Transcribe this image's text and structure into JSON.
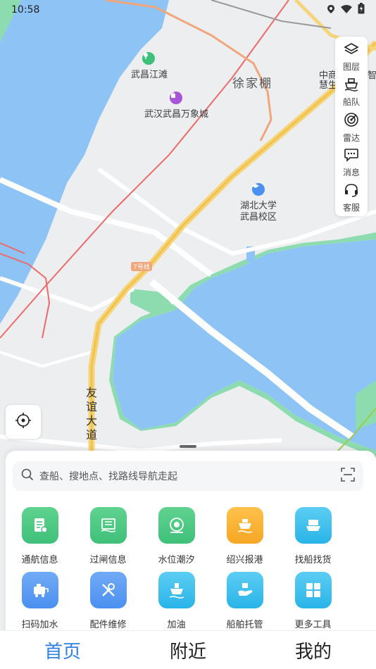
{
  "status_bar": {
    "time": "10:58"
  },
  "map": {
    "labels": {
      "wuchang_jiangtan": "武昌江滩",
      "xujiapeng": "徐家棚",
      "wanxiangcheng": "武汉武昌万象城",
      "hubei_univ_line1": "湖北大学",
      "hubei_univ_line2": "武昌校区",
      "zhongshang_line1": "中商",
      "zhongshang_line2": "慧生",
      "zhi": "智",
      "road_youyi": "友谊大道",
      "metro_badge": "7号线"
    }
  },
  "side_toolbar": {
    "items": [
      {
        "label": "图层",
        "icon": "layers-icon"
      },
      {
        "label": "船队",
        "icon": "ship-fleet-icon"
      },
      {
        "label": "雷达",
        "icon": "radar-icon"
      },
      {
        "label": "消息",
        "icon": "message-icon"
      },
      {
        "label": "客服",
        "icon": "headset-icon"
      }
    ]
  },
  "search": {
    "placeholder": "查船、搜地点、找路线导航走起"
  },
  "grid": {
    "items": [
      {
        "label": "通航信息",
        "icon": "navigation-info-icon",
        "color": "#3fc07a"
      },
      {
        "label": "过闸信息",
        "icon": "lock-gate-icon",
        "color": "#3fc07a"
      },
      {
        "label": "水位潮汐",
        "icon": "water-level-icon",
        "color": "#3fc07a"
      },
      {
        "label": "绍兴报港",
        "icon": "port-report-icon",
        "color": "#f6a623"
      },
      {
        "label": "找船找货",
        "icon": "find-ship-cargo-icon",
        "color": "#29b4e8"
      },
      {
        "label": "扫码加水",
        "icon": "scan-water-icon",
        "color": "#4a90f0"
      },
      {
        "label": "配件维修",
        "icon": "repair-tools-icon",
        "color": "#4a90f0"
      },
      {
        "label": "加油",
        "icon": "refuel-ship-icon",
        "color": "#29b4e8"
      },
      {
        "label": "船舶托管",
        "icon": "ship-custody-icon",
        "color": "#29b4e8"
      },
      {
        "label": "更多工具",
        "icon": "more-tools-icon",
        "color": "#29b4e8"
      }
    ]
  },
  "tabs": [
    {
      "label": "首页",
      "active": true
    },
    {
      "label": "附近",
      "active": false
    },
    {
      "label": "我的",
      "active": false
    }
  ]
}
